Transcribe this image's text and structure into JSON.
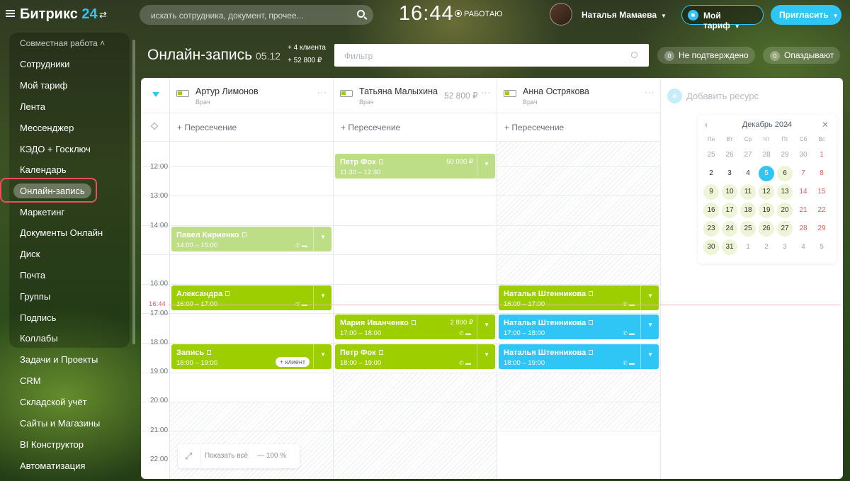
{
  "header": {
    "logo_text": "Битрикс",
    "logo_num": "24",
    "search_placeholder": "искать сотрудника, документ, прочее...",
    "clock": "16:44",
    "work_status": "РАБОТАЮ",
    "user_name": "Наталья Мамаева",
    "tariff_label": "Мой тариф",
    "invite_label": "Пригласить"
  },
  "sidebar": {
    "group_label": "Совместная работа",
    "items": [
      {
        "label": "Сотрудники"
      },
      {
        "label": "Мой тариф"
      },
      {
        "label": "Лента"
      },
      {
        "label": "Мессенджер"
      },
      {
        "label": "КЭДО + Госключ"
      },
      {
        "label": "Календарь"
      },
      {
        "label": "Онлайн-запись",
        "active": true
      },
      {
        "label": "Маркетинг"
      },
      {
        "label": "Документы Онлайн"
      },
      {
        "label": "Диск"
      },
      {
        "label": "Почта"
      },
      {
        "label": "Группы"
      },
      {
        "label": "Подпись"
      },
      {
        "label": "Коллабы"
      },
      {
        "label": "Задачи и Проекты"
      },
      {
        "label": "CRM"
      },
      {
        "label": "Складской учёт"
      },
      {
        "label": "Сайты и Магазины"
      },
      {
        "label": "BI Конструктор"
      },
      {
        "label": "Автоматизация"
      }
    ]
  },
  "page": {
    "title": "Онлайн-запись",
    "date": "05.12",
    "stat_clients": "+ 4 клиента",
    "stat_sum": "+ 52 800 ₽",
    "filter_placeholder": "Фильтр",
    "counters": [
      {
        "count": "0",
        "label": "Не подтверждено"
      },
      {
        "count": "0",
        "label": "Опаздывают"
      }
    ]
  },
  "resources": [
    {
      "name": "Артур Лимонов",
      "role": "Врач",
      "price": ""
    },
    {
      "name": "Татьяна Малыхина",
      "role": "Врач",
      "price": "52 800 ₽"
    },
    {
      "name": "Анна Острякова",
      "role": "Врач",
      "price": ""
    }
  ],
  "add_resource_label": "Добавить ресурс",
  "intersection_label": "+ Пересечение",
  "times": [
    "12:00",
    "13:00",
    "14:00",
    "16:00",
    "17:00",
    "18:00",
    "19:00",
    "20:00",
    "21:00",
    "22:00"
  ],
  "now_label": "16:44",
  "events": [
    {
      "title": "Петр Фок",
      "time": "11:30 – 12:30",
      "price": "50 000 ₽",
      "color": "#bdde87"
    },
    {
      "title": "Павел Кириенко",
      "time": "14:00 – 15:00",
      "price": "",
      "color": "#bdde87"
    },
    {
      "title": "Александра",
      "time": "16:00 – 17:00",
      "price": "",
      "color": "#9dcf00"
    },
    {
      "title": "Наталья Штенникова",
      "time": "16:00 – 17:00",
      "price": "",
      "color": "#9dcf00"
    },
    {
      "title": "Мария Иванченко",
      "time": "17:00 – 18:00",
      "price": "2 800 ₽",
      "color": "#9dcf00"
    },
    {
      "title": "Наталья Штенникова",
      "time": "17:00 – 18:00",
      "price": "",
      "color": "#2fc6f6"
    },
    {
      "title": "Запись",
      "time": "18:00 – 19:00",
      "price": "",
      "color": "#9dcf00",
      "badge": "+ клиент"
    },
    {
      "title": "Петр Фок",
      "time": "18:00 – 19:00",
      "price": "",
      "color": "#9dcf00"
    },
    {
      "title": "Наталья Штенникова",
      "time": "18:00 – 19:00",
      "price": "",
      "color": "#2fc6f6"
    }
  ],
  "zoom": {
    "show_all": "Показать всё",
    "level": "— 100 %"
  },
  "calendar": {
    "month": "Декабрь 2024",
    "weekdays": [
      "Пн",
      "Вт",
      "Ср",
      "Чт",
      "Пт",
      "Сб",
      "Вс"
    ],
    "days": [
      {
        "d": "25",
        "t": "other"
      },
      {
        "d": "26",
        "t": "other"
      },
      {
        "d": "27",
        "t": "other"
      },
      {
        "d": "28",
        "t": "other"
      },
      {
        "d": "29",
        "t": "other"
      },
      {
        "d": "30",
        "t": "other"
      },
      {
        "d": "1",
        "t": "weekend"
      },
      {
        "d": "2",
        "t": ""
      },
      {
        "d": "3",
        "t": ""
      },
      {
        "d": "4",
        "t": ""
      },
      {
        "d": "5",
        "t": "today"
      },
      {
        "d": "6",
        "t": "busy"
      },
      {
        "d": "7",
        "t": "weekend"
      },
      {
        "d": "8",
        "t": "weekend"
      },
      {
        "d": "9",
        "t": "busy"
      },
      {
        "d": "10",
        "t": "busy"
      },
      {
        "d": "11",
        "t": "busy"
      },
      {
        "d": "12",
        "t": "busy"
      },
      {
        "d": "13",
        "t": "busy"
      },
      {
        "d": "14",
        "t": "weekend"
      },
      {
        "d": "15",
        "t": "weekend"
      },
      {
        "d": "16",
        "t": "busy"
      },
      {
        "d": "17",
        "t": "busy"
      },
      {
        "d": "18",
        "t": "busy"
      },
      {
        "d": "19",
        "t": "busy"
      },
      {
        "d": "20",
        "t": "busy"
      },
      {
        "d": "21",
        "t": "weekend"
      },
      {
        "d": "22",
        "t": "weekend"
      },
      {
        "d": "23",
        "t": "busy"
      },
      {
        "d": "24",
        "t": "busy"
      },
      {
        "d": "25",
        "t": "busy"
      },
      {
        "d": "26",
        "t": "busy"
      },
      {
        "d": "27",
        "t": "busy"
      },
      {
        "d": "28",
        "t": "weekend"
      },
      {
        "d": "29",
        "t": "weekend"
      },
      {
        "d": "30",
        "t": "busy"
      },
      {
        "d": "31",
        "t": "busy"
      },
      {
        "d": "1",
        "t": "other"
      },
      {
        "d": "2",
        "t": "other"
      },
      {
        "d": "3",
        "t": "other"
      },
      {
        "d": "4",
        "t": "other"
      },
      {
        "d": "5",
        "t": "other"
      }
    ]
  }
}
